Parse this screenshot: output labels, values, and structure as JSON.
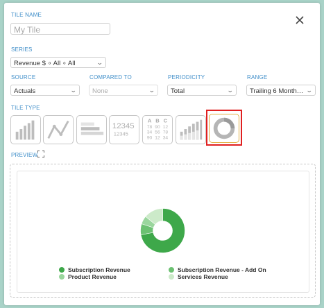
{
  "dialog": {
    "tile_name_label": "TILE NAME",
    "tile_name_placeholder": "My Tile",
    "series_label": "SERIES",
    "series_value": "Revenue $ ∘ All ∘ All",
    "source_label": "SOURCE",
    "source_value": "Actuals",
    "compared_label": "COMPARED TO",
    "compared_value": "None",
    "periodicity_label": "PERIODICITY",
    "periodicity_value": "Total",
    "range_label": "RANGE",
    "range_value": "Trailing 6 Month…",
    "tile_type_label": "TILE TYPE",
    "preview_label": "PREVIEW"
  },
  "tile_types": [
    {
      "name": "bar-chart-icon"
    },
    {
      "name": "line-chart-icon"
    },
    {
      "name": "horizontal-bar-icon"
    },
    {
      "name": "number-icon",
      "text_top": "12345",
      "text_bottom": "12345"
    },
    {
      "name": "table-icon",
      "cols": [
        "A",
        "B",
        "C"
      ],
      "rows": [
        [
          "78",
          "90",
          "12"
        ],
        [
          "34",
          "56",
          "78"
        ],
        [
          "90",
          "12",
          "34"
        ]
      ]
    },
    {
      "name": "stacked-bar-icon"
    },
    {
      "name": "donut-icon",
      "selected": true
    }
  ],
  "chart_data": {
    "type": "pie",
    "donut": true,
    "slices": [
      {
        "label": "Subscription Revenue",
        "value": 72,
        "color": "#3ea84a"
      },
      {
        "label": "Subscription Revenue - Add On",
        "value": 8,
        "color": "#6cc172"
      },
      {
        "label": "Product Revenue",
        "value": 6,
        "color": "#9ad69d"
      },
      {
        "label": "Services Revenue",
        "value": 14,
        "color": "#cceac9"
      }
    ],
    "legend": [
      "Subscription Revenue",
      "Subscription Revenue - Add On",
      "Product Revenue",
      "Services Revenue"
    ]
  },
  "colors": {
    "accent": "#3f8ec9",
    "highlight": "#e02020",
    "border": "#cfcfcf"
  }
}
